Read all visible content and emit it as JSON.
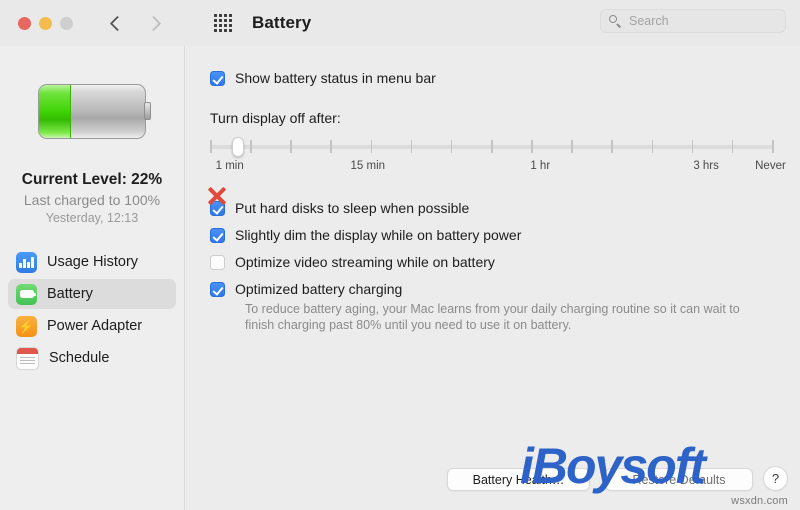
{
  "window": {
    "title": "Battery",
    "traffic_lights": [
      {
        "name": "close",
        "color": "#e8685f"
      },
      {
        "name": "minimize",
        "color": "#f3bc4e"
      },
      {
        "name": "zoom",
        "color": "#cfcfcf"
      }
    ],
    "nav": {
      "back": "back-chevron",
      "forward": "forward-chevron",
      "grid": "show-all-grid"
    }
  },
  "search": {
    "placeholder": "Search",
    "value": "",
    "icon": "search-icon"
  },
  "sidebar": {
    "battery_graphic": {
      "icon": "battery-icon",
      "fill_percent": 22,
      "fill_color": "#3fd306"
    },
    "current_level": "Current Level: 22%",
    "last_charged": "Last charged to 100%",
    "last_charged_time": "Yesterday, 12:13",
    "items": [
      {
        "label": "Usage History",
        "icon": "bar-chart-icon",
        "icon_color": "#2f7be4",
        "selected": false
      },
      {
        "label": "Battery",
        "icon": "battery-icon",
        "icon_color": "#43c256",
        "selected": true
      },
      {
        "label": "Power Adapter",
        "icon": "lightning-bolt-icon",
        "icon_color": "#f29219",
        "selected": false
      },
      {
        "label": "Schedule",
        "icon": "calendar-icon",
        "icon_color": "#e0564a",
        "selected": false
      }
    ]
  },
  "main": {
    "show_status": {
      "label": "Show battery status in menu bar",
      "checked": true
    },
    "display_off": {
      "label": "Turn display off after:",
      "tick_count": 15,
      "thumb_position_percent": 4,
      "labels": [
        {
          "text": "1 min",
          "position_percent": 1
        },
        {
          "text": "15 min",
          "position_percent": 25
        },
        {
          "text": "1 hr",
          "position_percent": 57
        },
        {
          "text": "3 hrs",
          "position_percent": 86
        },
        {
          "text": "Never",
          "position_percent": 97
        }
      ]
    },
    "options": [
      {
        "label": "Put hard disks to sleep when possible",
        "checked": true,
        "marked": true
      },
      {
        "label": "Slightly dim the display while on battery power",
        "checked": true,
        "marked": false
      },
      {
        "label": "Optimize video streaming while on battery",
        "checked": false,
        "marked": false
      },
      {
        "label": "Optimized battery charging",
        "checked": true,
        "marked": false
      }
    ],
    "optimized_description": "To reduce battery aging, your Mac learns from your daily charging routine so it can wait to finish charging past 80% until you need to use it on battery."
  },
  "footer": {
    "battery_health": "Battery Health…",
    "restore_defaults": "Restore Defaults",
    "help": "?"
  },
  "watermarks": {
    "brand": "iBoysoft",
    "site": "wsxdn.com"
  }
}
